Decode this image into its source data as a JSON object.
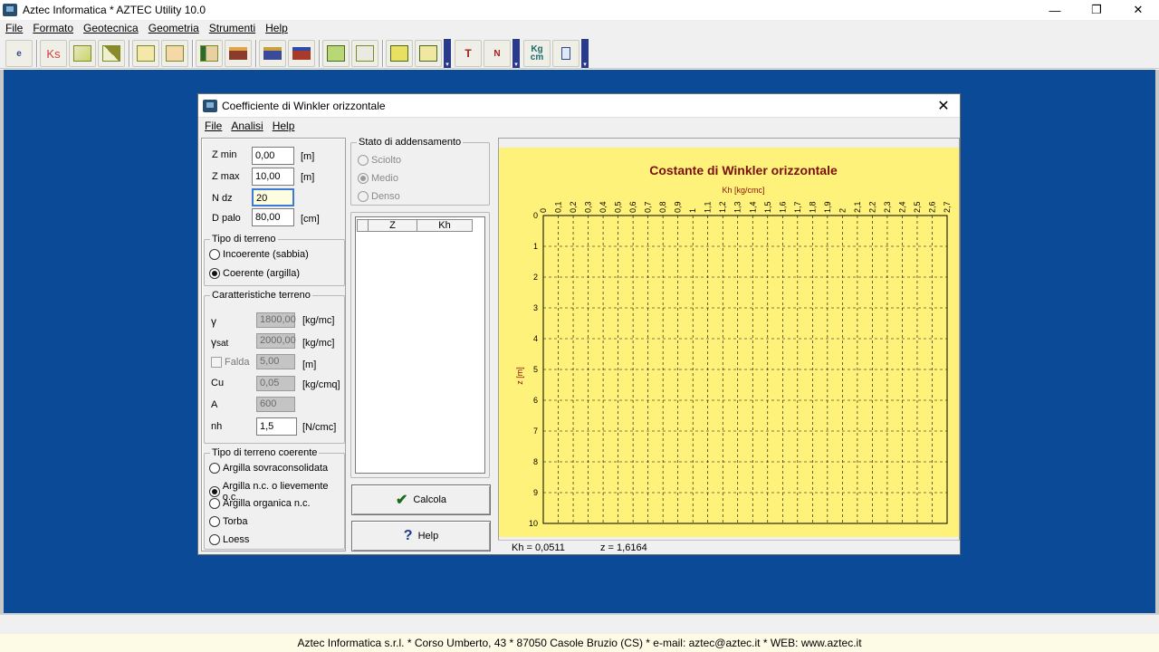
{
  "app": {
    "title": "Aztec Informatica * AZTEC Utility 10.0",
    "minimize": "—",
    "restore": "❐",
    "close": "✕"
  },
  "menu": [
    "File",
    "Formato",
    "Geotecnica",
    "Geometria",
    "Strumenti",
    "Help"
  ],
  "toolbar": {
    "btn_ks": "Ks",
    "btn_kg": "Kg",
    "btn_cm": "cm",
    "btn_e": "e",
    "btn_n": "N"
  },
  "dialog": {
    "title": "Coefficiente di Winkler orizzontale",
    "close": "✕",
    "menu": [
      "File",
      "Analisi",
      "Help"
    ],
    "params": {
      "zmin_label": "Z min",
      "zmin_value": "0,00",
      "zmin_unit": "[m]",
      "zmax_label": "Z max",
      "zmax_value": "10,00",
      "zmax_unit": "[m]",
      "ndz_label": "N dz",
      "ndz_value": "20",
      "dpalo_label": "D palo",
      "dpalo_value": "80,00",
      "dpalo_unit": "[cm]"
    },
    "tipo_terreno": {
      "title": "Tipo di terreno",
      "options": [
        "Incoerente (sabbia)",
        "Coerente (argilla)"
      ],
      "selected": 1
    },
    "caratteristiche": {
      "title": "Caratteristiche terreno",
      "gamma_label": "γ",
      "gamma_value": "1800,00",
      "gamma_unit": "[kg/mc]",
      "gammasat_label": "γ",
      "gammasat_sub": "sat",
      "gammasat_value": "2000,00",
      "gammasat_unit": "[kg/mc]",
      "falda_label": "Falda",
      "falda_value": "5,00",
      "falda_unit": "[m]",
      "cu_label": "Cu",
      "cu_value": "0,05",
      "cu_unit": "[kg/cmq]",
      "a_label": "A",
      "a_value": "600",
      "nh_label": "nh",
      "nh_value": "1,5",
      "nh_unit": "[N/cmc]"
    },
    "tipo_coerente": {
      "title": "Tipo di terreno coerente",
      "options": [
        "Argilla sovraconsolidata",
        "Argilla n.c. o lievemente o.c.",
        "Argilla organica n.c.",
        "Torba",
        "Loess"
      ],
      "selected": 1
    },
    "stato": {
      "title": "Stato di addensamento",
      "options": [
        "Sciolto",
        "Medio",
        "Denso"
      ],
      "selected": 1
    },
    "table": {
      "col_z": "Z",
      "col_kh": "Kh"
    },
    "calcola_label": "Calcola",
    "help_label": "Help",
    "status": {
      "kh": "Kh = 0,0511",
      "z": "z = 1,6164"
    }
  },
  "footer": "Aztec Informatica s.r.l. * Corso Umberto, 43 * 87050 Casole Bruzio (CS) * e-mail:   aztec@aztec.it * WEB: www.aztec.it",
  "chart_data": {
    "type": "line",
    "title": "Costante di Winkler orizzontale",
    "xlabel": "Kh [kg/cmc]",
    "ylabel": "z [m]",
    "xlim": [
      0,
      2.7
    ],
    "ylim": [
      0,
      10
    ],
    "x_ticks": [
      "0",
      "0,1",
      "0,2",
      "0,3",
      "0,4",
      "0,5",
      "0,6",
      "0,7",
      "0,8",
      "0,9",
      "1",
      "1,1",
      "1,2",
      "1,3",
      "1,4",
      "1,5",
      "1,6",
      "1,7",
      "1,8",
      "1,9",
      "2",
      "2,1",
      "2,2",
      "2,3",
      "2,4",
      "2,5",
      "2,6",
      "2,7"
    ],
    "y_ticks": [
      "0",
      "1",
      "2",
      "3",
      "4",
      "5",
      "6",
      "7",
      "8",
      "9",
      "10"
    ],
    "grid": true,
    "series": [],
    "colors": {
      "background": "#fff27a",
      "title": "#7a1010",
      "axis_label": "#8a1010",
      "grid": "#000000"
    }
  }
}
